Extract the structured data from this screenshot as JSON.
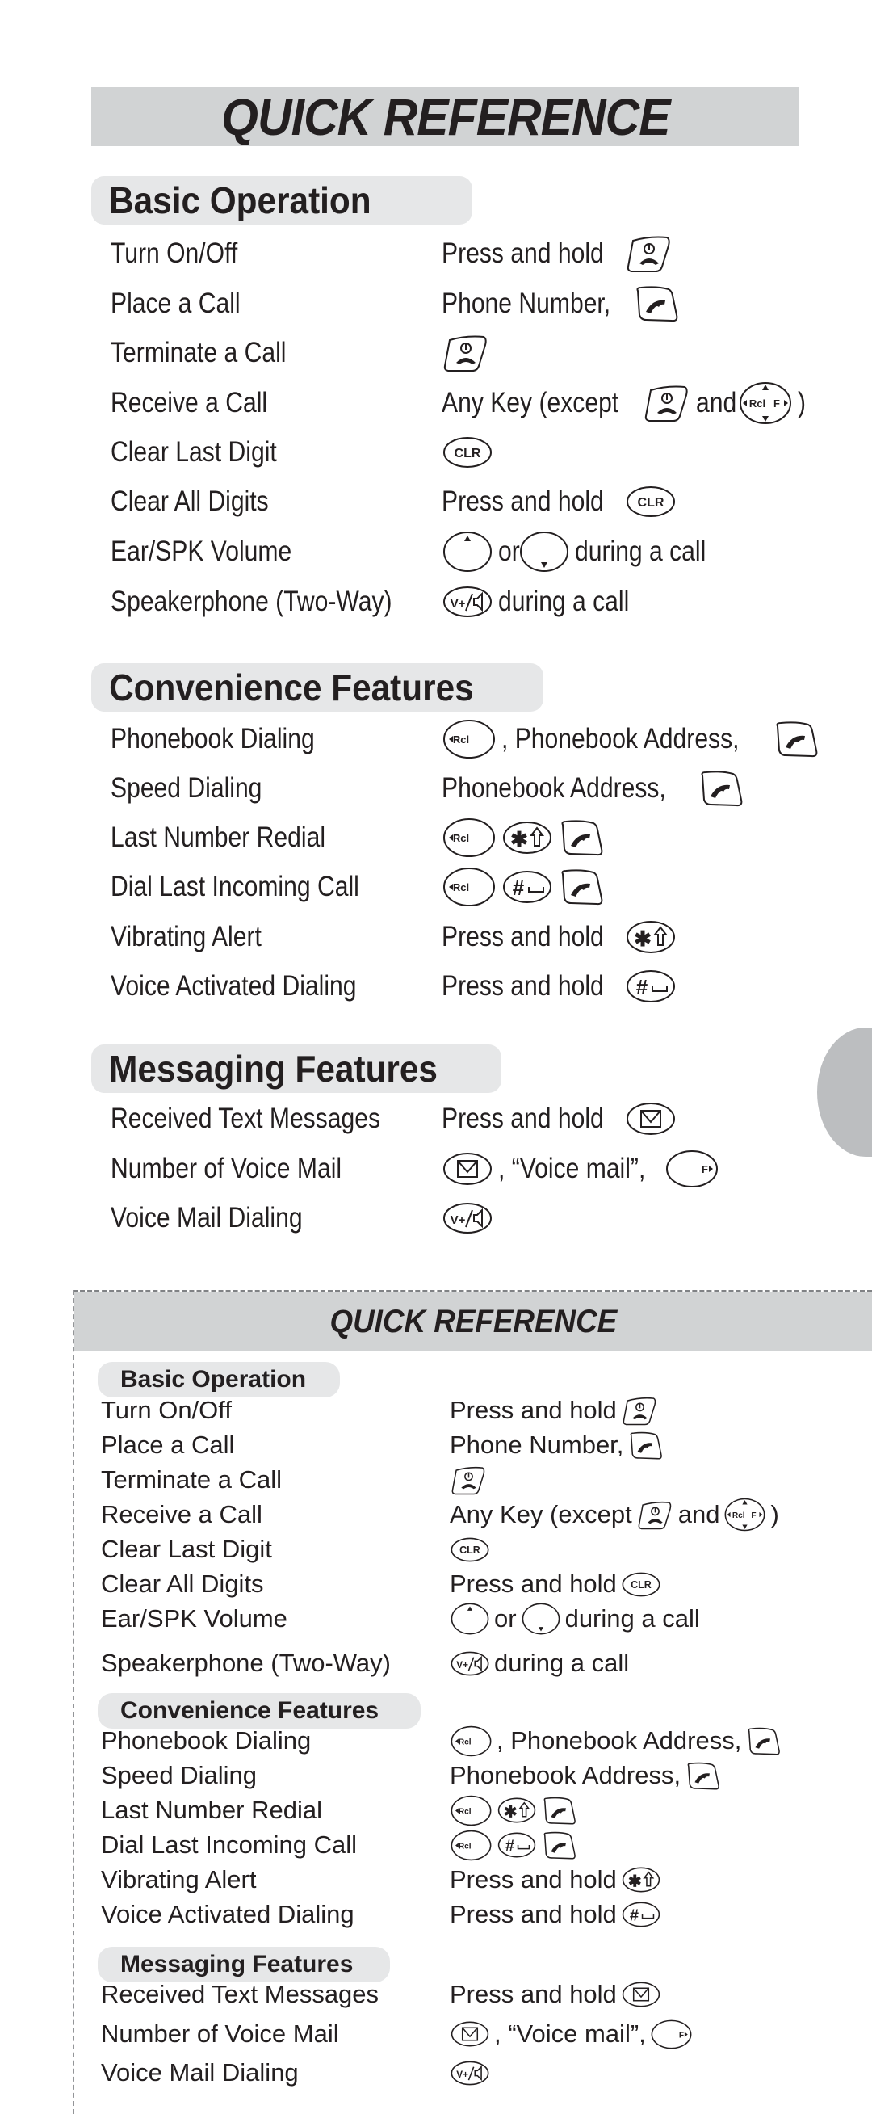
{
  "document": {
    "title": "QUICK REFERENCE",
    "accent_colors": {
      "title_bar": "#d1d3d4",
      "section_pill": "#e6e7e8",
      "side_tab": "#bcbec0",
      "text": "#231f20"
    }
  },
  "top_card": {
    "title": "QUICK REFERENCE",
    "sections": [
      {
        "heading": "Basic Operation",
        "rows": [
          {
            "label": "Turn On/Off",
            "action": [
              {
                "text": "Press and hold"
              },
              {
                "icon": "end-power-key"
              }
            ]
          },
          {
            "label": "Place a Call",
            "action": [
              {
                "text": "Phone Number,"
              },
              {
                "icon": "send-key"
              }
            ]
          },
          {
            "label": "Terminate a Call",
            "action": [
              {
                "icon": "end-power-key"
              }
            ]
          },
          {
            "label": "Receive a Call",
            "action": [
              {
                "text": "Any Key (except"
              },
              {
                "icon": "end-power-key"
              },
              {
                "text": "and"
              },
              {
                "icon": "nav-key"
              },
              {
                "text": ")"
              }
            ]
          },
          {
            "label": "Clear Last Digit",
            "action": [
              {
                "icon": "clr-key"
              }
            ]
          },
          {
            "label": "Clear All Digits",
            "action": [
              {
                "text": "Press and hold"
              },
              {
                "icon": "clr-key"
              }
            ]
          },
          {
            "label": "Ear/SPK Volume",
            "action": [
              {
                "icon": "volume-up-key"
              },
              {
                "text": "or"
              },
              {
                "icon": "volume-down-key"
              },
              {
                "text": "during a call"
              }
            ]
          },
          {
            "label": "Speakerphone (Two-Way)",
            "action": [
              {
                "icon": "speaker-key"
              },
              {
                "text": "during a call"
              }
            ]
          }
        ]
      },
      {
        "heading": "Convenience Features",
        "rows": [
          {
            "label": "Phonebook Dialing",
            "action": [
              {
                "icon": "rcl-key"
              },
              {
                "text": ", Phonebook Address,"
              },
              {
                "icon": "send-key"
              }
            ]
          },
          {
            "label": "Speed Dialing",
            "action": [
              {
                "text": "Phonebook Address,"
              },
              {
                "icon": "send-key"
              }
            ]
          },
          {
            "label": "Last Number Redial",
            "action": [
              {
                "icon": "rcl-key"
              },
              {
                "icon": "star-shift-key"
              },
              {
                "icon": "send-key"
              }
            ]
          },
          {
            "label": "Dial Last Incoming Call",
            "action": [
              {
                "icon": "rcl-key"
              },
              {
                "icon": "pound-space-key"
              },
              {
                "icon": "send-key"
              }
            ]
          },
          {
            "label": "Vibrating Alert",
            "action": [
              {
                "text": "Press and hold"
              },
              {
                "icon": "star-shift-key"
              }
            ]
          },
          {
            "label": "Voice Activated Dialing",
            "action": [
              {
                "text": "Press and hold"
              },
              {
                "icon": "pound-space-key"
              }
            ]
          }
        ]
      },
      {
        "heading": "Messaging Features",
        "rows": [
          {
            "label": "Received Text Messages",
            "action": [
              {
                "text": "Press and hold"
              },
              {
                "icon": "message-key"
              }
            ]
          },
          {
            "label": "Number of Voice Mail",
            "action": [
              {
                "icon": "message-key"
              },
              {
                "text": ", “Voice mail”,"
              },
              {
                "icon": "f-key"
              }
            ]
          },
          {
            "label": "Voice Mail Dialing",
            "action": [
              {
                "icon": "speaker-key"
              }
            ]
          }
        ]
      }
    ]
  },
  "bottom_card": {
    "title": "QUICK REFERENCE",
    "sections": [
      {
        "heading": "Basic Operation",
        "rows": [
          {
            "label": "Turn On/Off",
            "action": [
              {
                "text": "Press and hold"
              },
              {
                "icon": "end-power-key"
              }
            ]
          },
          {
            "label": "Place a Call",
            "action": [
              {
                "text": "Phone Number,"
              },
              {
                "icon": "send-key"
              }
            ]
          },
          {
            "label": "Terminate a Call",
            "action": [
              {
                "icon": "end-power-key"
              }
            ]
          },
          {
            "label": "Receive a Call",
            "action": [
              {
                "text": "Any Key (except"
              },
              {
                "icon": "end-power-key"
              },
              {
                "text": "and"
              },
              {
                "icon": "nav-key"
              },
              {
                "text": ")"
              }
            ]
          },
          {
            "label": "Clear Last Digit",
            "action": [
              {
                "icon": "clr-key"
              }
            ]
          },
          {
            "label": "Clear All Digits",
            "action": [
              {
                "text": "Press and hold"
              },
              {
                "icon": "clr-key"
              }
            ]
          },
          {
            "label": "Ear/SPK Volume",
            "action": [
              {
                "icon": "volume-up-key"
              },
              {
                "text": "or"
              },
              {
                "icon": "volume-down-key"
              },
              {
                "text": "during a call"
              }
            ]
          },
          {
            "label": "Speakerphone (Two-Way)",
            "action": [
              {
                "icon": "speaker-key"
              },
              {
                "text": "during a call"
              }
            ]
          }
        ]
      },
      {
        "heading": "Convenience Features",
        "rows": [
          {
            "label": "Phonebook Dialing",
            "action": [
              {
                "icon": "rcl-key"
              },
              {
                "text": ", Phonebook Address,"
              },
              {
                "icon": "send-key"
              }
            ]
          },
          {
            "label": "Speed Dialing",
            "action": [
              {
                "text": "Phonebook Address,"
              },
              {
                "icon": "send-key"
              }
            ]
          },
          {
            "label": "Last Number Redial",
            "action": [
              {
                "icon": "rcl-key"
              },
              {
                "icon": "star-shift-key"
              },
              {
                "icon": "send-key"
              }
            ]
          },
          {
            "label": "Dial Last Incoming Call",
            "action": [
              {
                "icon": "rcl-key"
              },
              {
                "icon": "pound-space-key"
              },
              {
                "icon": "send-key"
              }
            ]
          },
          {
            "label": "Vibrating Alert",
            "action": [
              {
                "text": "Press and hold"
              },
              {
                "icon": "star-shift-key"
              }
            ]
          },
          {
            "label": "Voice Activated Dialing",
            "action": [
              {
                "text": "Press and hold"
              },
              {
                "icon": "pound-space-key"
              }
            ]
          }
        ]
      },
      {
        "heading": "Messaging Features",
        "rows": [
          {
            "label": "Received Text Messages",
            "action": [
              {
                "text": "Press and hold"
              },
              {
                "icon": "message-key"
              }
            ]
          },
          {
            "label": "Number of Voice Mail",
            "action": [
              {
                "icon": "message-key"
              },
              {
                "text": ", “Voice mail”,"
              },
              {
                "icon": "f-key"
              }
            ]
          },
          {
            "label": "Voice Mail Dialing",
            "action": [
              {
                "icon": "speaker-key"
              }
            ]
          }
        ]
      }
    ]
  },
  "key_icons": {
    "end-power-key": {
      "glyph": "⏻☎",
      "description": "End/Power key"
    },
    "send-key": {
      "glyph": "✆",
      "description": "Send key"
    },
    "nav-key": {
      "glyph": "◂Rcl F▸",
      "description": "Navigation key"
    },
    "clr-key": {
      "glyph": "CLR",
      "description": "Clear key"
    },
    "volume-up-key": {
      "glyph": "▴",
      "description": "Volume up"
    },
    "volume-down-key": {
      "glyph": "▾",
      "description": "Volume down"
    },
    "speaker-key": {
      "glyph": "V+/◁",
      "description": "Voice mail / Speaker key"
    },
    "rcl-key": {
      "glyph": "◂Rcl",
      "description": "Recall key"
    },
    "star-shift-key": {
      "glyph": "✱⇧",
      "description": "Star/Shift key"
    },
    "pound-space-key": {
      "glyph": "#⎵",
      "description": "Pound/Space key"
    },
    "message-key": {
      "glyph": "✉",
      "description": "Message key"
    },
    "f-key": {
      "glyph": "F▸",
      "description": "Function key"
    }
  }
}
